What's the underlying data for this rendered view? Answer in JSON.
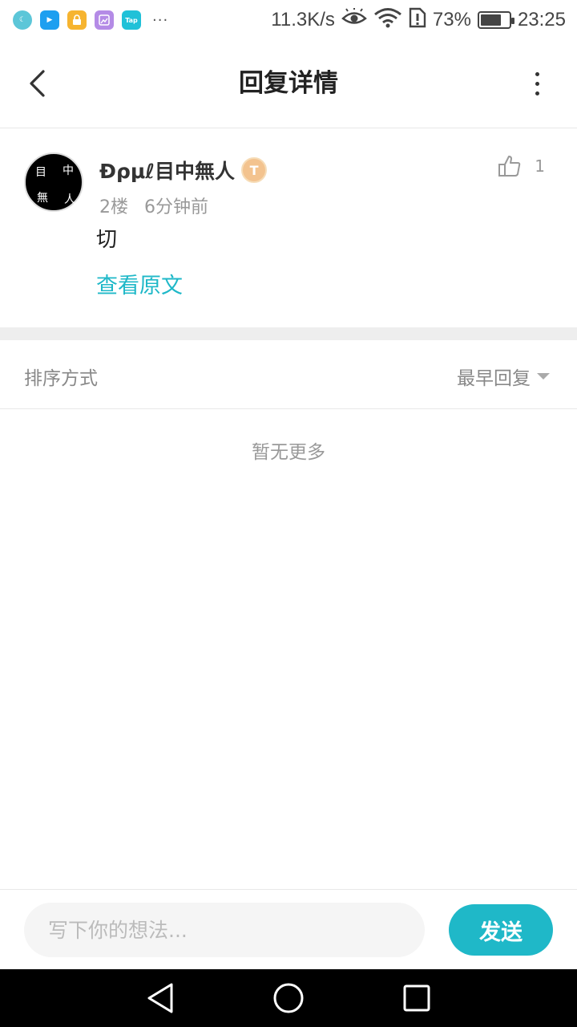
{
  "status_bar": {
    "apps": [
      {
        "icon": "moon-app-icon",
        "color": "#5cc6d8",
        "glyph": "☾"
      },
      {
        "icon": "play-app-icon",
        "color": "#1d9ff0",
        "glyph": "▶"
      },
      {
        "icon": "lock-app-icon",
        "color": "#f6b430",
        "glyph": "🔒"
      },
      {
        "icon": "gallery-app-icon",
        "color": "#b48be6",
        "glyph": "▣"
      },
      {
        "icon": "tap-app-icon",
        "color": "#20c1d8",
        "glyph": "Tap"
      }
    ],
    "more": "···",
    "network_speed": "11.3K/s",
    "battery_percent": "73%",
    "battery_level": 0.73,
    "time": "23:25"
  },
  "header": {
    "title": "回复详情"
  },
  "comment": {
    "avatar_chars": [
      "目",
      "中",
      "無",
      "人"
    ],
    "username": "Ɖρμℓ目中無人",
    "level_badge": "T",
    "floor": "2楼",
    "time_ago": "6分钟前",
    "likes": "1",
    "text": "切",
    "view_original": "查看原文"
  },
  "sort": {
    "label": "排序方式",
    "selected": "最早回复"
  },
  "empty_text": "暂无更多",
  "input_bar": {
    "placeholder": "写下你的想法...",
    "send_label": "发送"
  },
  "colors": {
    "accent": "#1fb8c8"
  }
}
